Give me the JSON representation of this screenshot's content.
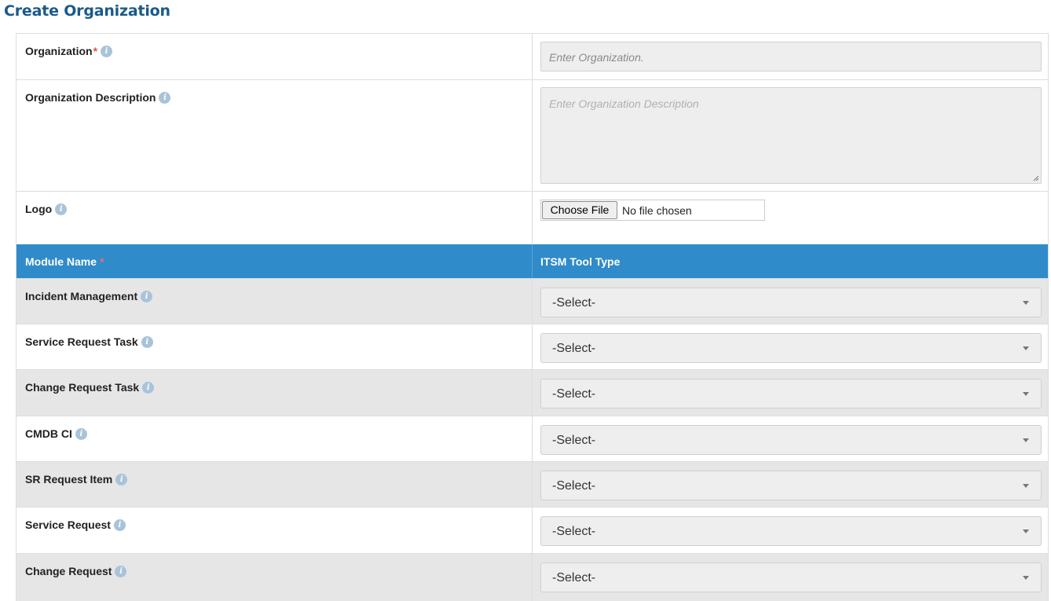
{
  "page": {
    "title": "Create Organization"
  },
  "form": {
    "organization": {
      "label": "Organization",
      "required_mark": "*",
      "placeholder": "Enter Organization.",
      "value": ""
    },
    "description": {
      "label": "Organization Description",
      "placeholder": "Enter Organization Description",
      "value": ""
    },
    "logo": {
      "label": "Logo",
      "button_label": "Choose File",
      "status": "No file chosen"
    }
  },
  "modules_table": {
    "headers": {
      "module_name": "Module Name",
      "module_required_mark": "*",
      "tool_type": "ITSM Tool Type"
    },
    "rows": [
      {
        "name": "Incident Management",
        "selected": "-Select-"
      },
      {
        "name": "Service Request Task",
        "selected": "-Select-"
      },
      {
        "name": "Change Request Task",
        "selected": "-Select-"
      },
      {
        "name": "CMDB CI",
        "selected": "-Select-"
      },
      {
        "name": "SR Request Item",
        "selected": "-Select-"
      },
      {
        "name": "Service Request",
        "selected": "-Select-"
      },
      {
        "name": "Change Request",
        "selected": "-Select-"
      }
    ]
  },
  "icons": {
    "info": "info-icon",
    "dropdown": "chevron-down-icon",
    "resize": "resize-grip-icon"
  },
  "colors": {
    "title": "#1a5a8a",
    "header_bg": "#2f8bc9",
    "row_alt": "#e6e6e6",
    "required": "#d9534f",
    "info_icon": "#a9c3d9"
  }
}
